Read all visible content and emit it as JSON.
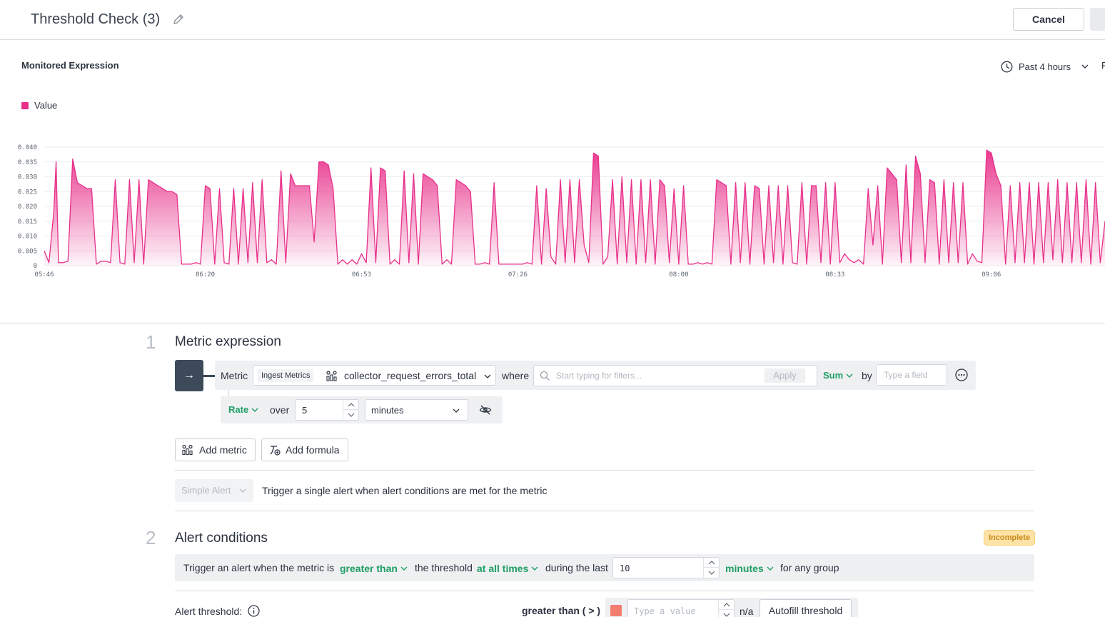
{
  "header": {
    "title": "Threshold Check (3)",
    "cancel_label": "Cancel"
  },
  "chart_panel": {
    "title": "Monitored Expression",
    "time_range": "Past 4 hours",
    "refresh_stub": "F"
  },
  "chart_data": {
    "type": "area",
    "series": [
      {
        "name": "Value",
        "color": "#e8308a"
      }
    ],
    "y_ticks": [
      "0",
      "0.005",
      "0.010",
      "0.015",
      "0.020",
      "0.025",
      "0.030",
      "0.035",
      "0.040"
    ],
    "ylim": [
      0,
      0.04
    ],
    "x_ticks": [
      "05:46",
      "06:20",
      "06:53",
      "07:26",
      "08:00",
      "08:33",
      "09:06"
    ],
    "x_tick_minutes": [
      346,
      380,
      413,
      446,
      480,
      513,
      546
    ],
    "xlim_minutes": [
      346,
      570
    ],
    "points": [
      [
        346,
        0.005
      ],
      [
        347,
        0.001
      ],
      [
        348,
        0.018
      ],
      [
        348.5,
        0.035
      ],
      [
        349,
        0.001
      ],
      [
        350,
        0.001
      ],
      [
        351,
        0.0015
      ],
      [
        352,
        0.036
      ],
      [
        353,
        0.028
      ],
      [
        354,
        0.027
      ],
      [
        355,
        0.026
      ],
      [
        356,
        0.026
      ],
      [
        357,
        0.0005
      ],
      [
        358,
        0.0015
      ],
      [
        359,
        0.0015
      ],
      [
        360,
        0.001
      ],
      [
        361,
        0.029
      ],
      [
        362,
        0.001
      ],
      [
        363,
        0.0005
      ],
      [
        364,
        0.029
      ],
      [
        365,
        0.001
      ],
      [
        366,
        0.029
      ],
      [
        367,
        0.0005
      ],
      [
        368,
        0.029
      ],
      [
        369,
        0.028
      ],
      [
        370,
        0.027
      ],
      [
        371,
        0.026
      ],
      [
        372,
        0.025
      ],
      [
        373,
        0.025
      ],
      [
        374,
        0.024
      ],
      [
        375,
        0.0005
      ],
      [
        376,
        0.0005
      ],
      [
        377,
        0.0005
      ],
      [
        378,
        0.001
      ],
      [
        379,
        0.0005
      ],
      [
        380,
        0.027
      ],
      [
        381,
        0.026
      ],
      [
        382,
        0.0005
      ],
      [
        383,
        0.026
      ],
      [
        384,
        0.001
      ],
      [
        385,
        0.0005
      ],
      [
        386,
        0.026
      ],
      [
        387,
        0.0005
      ],
      [
        388,
        0.026
      ],
      [
        389,
        0.001
      ],
      [
        390,
        0.028
      ],
      [
        391,
        0.001
      ],
      [
        392,
        0.029
      ],
      [
        393,
        0.001
      ],
      [
        394,
        0.002
      ],
      [
        395,
        0.0005
      ],
      [
        396,
        0.032
      ],
      [
        397,
        0.001
      ],
      [
        398,
        0.031
      ],
      [
        399,
        0.027
      ],
      [
        400,
        0.027
      ],
      [
        401,
        0.027
      ],
      [
        402,
        0.027
      ],
      [
        403,
        0.008
      ],
      [
        404,
        0.035
      ],
      [
        405,
        0.035
      ],
      [
        406,
        0.034
      ],
      [
        407,
        0.026
      ],
      [
        408,
        0.0005
      ],
      [
        409,
        0.002
      ],
      [
        410,
        0.0005
      ],
      [
        411,
        0.002
      ],
      [
        412,
        0.0005
      ],
      [
        413,
        0.004
      ],
      [
        414,
        0.001
      ],
      [
        415,
        0.033
      ],
      [
        416,
        0.001
      ],
      [
        417,
        0.033
      ],
      [
        418,
        0.032
      ],
      [
        419,
        0.0005
      ],
      [
        420,
        0.002
      ],
      [
        421,
        0.0005
      ],
      [
        422,
        0.032
      ],
      [
        423,
        0.001
      ],
      [
        424,
        0.031
      ],
      [
        425,
        0.0005
      ],
      [
        426,
        0.031
      ],
      [
        427,
        0.03
      ],
      [
        428,
        0.029
      ],
      [
        429,
        0.027
      ],
      [
        430,
        0.0005
      ],
      [
        431,
        0.002
      ],
      [
        432,
        0.0005
      ],
      [
        433,
        0.029
      ],
      [
        434,
        0.028
      ],
      [
        435,
        0.027
      ],
      [
        436,
        0.025
      ],
      [
        437,
        0.0005
      ],
      [
        438,
        0.0005
      ],
      [
        439,
        0.001
      ],
      [
        440,
        0.0005
      ],
      [
        441,
        0.028
      ],
      [
        442,
        0.0005
      ],
      [
        443,
        0.0005
      ],
      [
        444,
        0.0005
      ],
      [
        445,
        0.0005
      ],
      [
        446,
        0.0005
      ],
      [
        447,
        0.0005
      ],
      [
        448,
        0.001
      ],
      [
        449,
        0.0005
      ],
      [
        450,
        0.027
      ],
      [
        451,
        0.0005
      ],
      [
        452,
        0.026
      ],
      [
        453,
        0.003
      ],
      [
        454,
        0.0005
      ],
      [
        455,
        0.029
      ],
      [
        456,
        0.001
      ],
      [
        457,
        0.029
      ],
      [
        458,
        0.001
      ],
      [
        459,
        0.029
      ],
      [
        460,
        0.007
      ],
      [
        461,
        0.001
      ],
      [
        462,
        0.038
      ],
      [
        463,
        0.037
      ],
      [
        464,
        0.0005
      ],
      [
        465,
        0.003
      ],
      [
        466,
        0.029
      ],
      [
        467,
        0.0005
      ],
      [
        468,
        0.03
      ],
      [
        469,
        0.001
      ],
      [
        470,
        0.029
      ],
      [
        471,
        0.0005
      ],
      [
        472,
        0.029
      ],
      [
        473,
        0.001
      ],
      [
        474,
        0.029
      ],
      [
        475,
        0.0005
      ],
      [
        476,
        0.029
      ],
      [
        477,
        0.027
      ],
      [
        478,
        0.001
      ],
      [
        479,
        0.026
      ],
      [
        480,
        0.0005
      ],
      [
        481,
        0.027
      ],
      [
        482,
        0.0005
      ],
      [
        483,
        0.0005
      ],
      [
        484,
        0.001
      ],
      [
        485,
        0.0005
      ],
      [
        486,
        0.001
      ],
      [
        487,
        0.0005
      ],
      [
        488,
        0.029
      ],
      [
        489,
        0.028
      ],
      [
        490,
        0.027
      ],
      [
        491,
        0.0005
      ],
      [
        492,
        0.028
      ],
      [
        493,
        0.001
      ],
      [
        494,
        0.028
      ],
      [
        495,
        0.0005
      ],
      [
        496,
        0.027
      ],
      [
        497,
        0.026
      ],
      [
        498,
        0.0005
      ],
      [
        499,
        0.027
      ],
      [
        500,
        0.001
      ],
      [
        501,
        0.027
      ],
      [
        502,
        0.0005
      ],
      [
        503,
        0.027
      ],
      [
        504,
        0.001
      ],
      [
        505,
        0.0005
      ],
      [
        506,
        0.028
      ],
      [
        507,
        0.0005
      ],
      [
        508,
        0.027
      ],
      [
        509,
        0.027
      ],
      [
        510,
        0.001
      ],
      [
        511,
        0.028
      ],
      [
        512,
        0.0005
      ],
      [
        513,
        0.028
      ],
      [
        514,
        0.001
      ],
      [
        515,
        0.004
      ],
      [
        516,
        0.002
      ],
      [
        517,
        0.001
      ],
      [
        518,
        0.002
      ],
      [
        519,
        0.0005
      ],
      [
        520,
        0.026
      ],
      [
        521,
        0.007
      ],
      [
        522,
        0.027
      ],
      [
        523,
        0.0005
      ],
      [
        524,
        0.033
      ],
      [
        525,
        0.031
      ],
      [
        526,
        0.029
      ],
      [
        527,
        0.001
      ],
      [
        528,
        0.034
      ],
      [
        529,
        0.001
      ],
      [
        530,
        0.037
      ],
      [
        531,
        0.031
      ],
      [
        532,
        0.001
      ],
      [
        533,
        0.029
      ],
      [
        534,
        0.028
      ],
      [
        535,
        0.0005
      ],
      [
        536,
        0.029
      ],
      [
        537,
        0.001
      ],
      [
        538,
        0.028
      ],
      [
        539,
        0.001
      ],
      [
        540,
        0.028
      ],
      [
        541,
        0.0005
      ],
      [
        542,
        0.004
      ],
      [
        543,
        0.0015
      ],
      [
        544,
        0.001
      ],
      [
        545,
        0.039
      ],
      [
        546,
        0.038
      ],
      [
        547,
        0.031
      ],
      [
        548,
        0.027
      ],
      [
        549,
        0.0005
      ],
      [
        550,
        0.027
      ],
      [
        551,
        0.001
      ],
      [
        552,
        0.028
      ],
      [
        553,
        0.001
      ],
      [
        554,
        0.028
      ],
      [
        555,
        0.0005
      ],
      [
        556,
        0.028
      ],
      [
        557,
        0.001
      ],
      [
        558,
        0.028
      ],
      [
        559,
        0.002
      ],
      [
        560,
        0.029
      ],
      [
        561,
        0.001
      ],
      [
        562,
        0.028
      ],
      [
        563,
        0.001
      ],
      [
        564,
        0.028
      ],
      [
        565,
        0.001
      ],
      [
        566,
        0.029
      ],
      [
        567,
        0.0005
      ],
      [
        568,
        0.028
      ],
      [
        569,
        0.001
      ],
      [
        570,
        0.015
      ]
    ]
  },
  "section1": {
    "number": "1",
    "title": "Metric expression",
    "arrow": "→",
    "metric_label": "Metric",
    "source_tag": "Ingest Metrics",
    "metric_name": "collector_request_errors_total",
    "where_label": "where",
    "filter_placeholder": "Start typing for filters...",
    "apply_label": "Apply",
    "aggregation": "Sum",
    "by_label": "by",
    "group_placeholder": "Type a field",
    "rate_label": "Rate",
    "over_label": "over",
    "window_value": "5",
    "window_unit": "minutes",
    "add_metric_label": "Add metric",
    "add_formula_label": "Add formula",
    "alert_type": "Simple Alert",
    "alert_type_desc": "Trigger a single alert when alert conditions are met for the metric"
  },
  "section2": {
    "number": "2",
    "title": "Alert conditions",
    "status_badge": "Incomplete",
    "cond_prefix": "Trigger an alert when the metric is",
    "comparator": "greater than",
    "cond_mid": "the threshold",
    "frequency": "at all times",
    "during_label": "during the last",
    "duration_value": "10",
    "duration_unit": "minutes",
    "group_scope": "for any group",
    "threshold_label": "Alert threshold:",
    "threshold_comparator": "greater than ( > )",
    "threshold_placeholder": "Type a value",
    "threshold_na": "n/a",
    "autofill_label": "Autofill threshold",
    "threshold_color": "#f47d6f"
  }
}
